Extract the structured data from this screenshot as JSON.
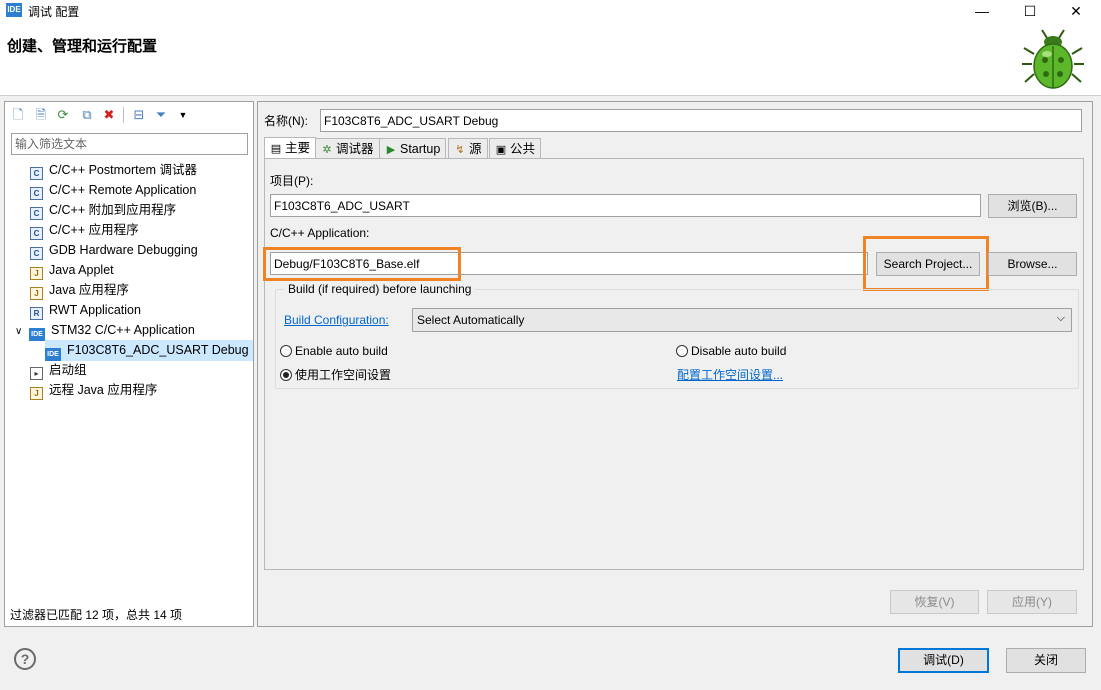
{
  "window": {
    "title": "调试 配置",
    "app_badge": "IDE",
    "minimize_glyph": "—",
    "maximize_glyph": "☐",
    "close_glyph": "✕"
  },
  "header": {
    "title": "创建、管理和运行配置"
  },
  "left": {
    "filter_placeholder": "输入筛选文本",
    "tree": [
      {
        "label": "C/C++ Postmortem 调试器",
        "icon": "c-icon",
        "badge": "C"
      },
      {
        "label": "C/C++ Remote Application",
        "icon": "c-icon",
        "badge": "C"
      },
      {
        "label": "C/C++ 附加到应用程序",
        "icon": "c-icon",
        "badge": "C"
      },
      {
        "label": "C/C++ 应用程序",
        "icon": "c-icon",
        "badge": "C"
      },
      {
        "label": "GDB Hardware Debugging",
        "icon": "c-icon",
        "badge": "C"
      },
      {
        "label": "Java Applet",
        "icon": "java-applet-icon",
        "badge": "J"
      },
      {
        "label": "Java 应用程序",
        "icon": "java-app-icon",
        "badge": "J"
      },
      {
        "label": "RWT Application",
        "icon": "rwt-icon",
        "badge": "R"
      },
      {
        "label": "STM32 C/C++ Application",
        "icon": "stm32-icon",
        "badge": "IDE"
      },
      {
        "label": "F103C8T6_ADC_USART Debug",
        "icon": "ide-config-icon",
        "badge": "IDE"
      },
      {
        "label": "启动组",
        "icon": "launch-group-icon",
        "badge": "▸"
      },
      {
        "label": "远程 Java 应用程序",
        "icon": "remote-java-icon",
        "badge": "J"
      }
    ],
    "expander": "∨",
    "status": "过滤器已匹配 12 项，总共 14 项"
  },
  "right": {
    "name_label": "名称(N):",
    "name_value": "F103C8T6_ADC_USART Debug",
    "tabs": [
      {
        "label": "主要",
        "glyph": "▤"
      },
      {
        "label": "调试器",
        "glyph": "✲"
      },
      {
        "label": "Startup",
        "glyph": "▶"
      },
      {
        "label": "源",
        "glyph": "↯"
      },
      {
        "label": "公共",
        "glyph": "▣"
      }
    ],
    "project_label": "项目(P):",
    "project_value": "F103C8T6_ADC_USART",
    "browse_p": "浏览(B)...",
    "app_label": "C/C++ Application:",
    "app_value": "Debug/F103C8T6_Base.elf",
    "search_project": "Search Project...",
    "browse": "Browse...",
    "build_legend": "Build (if required) before launching",
    "build_config_link": "Build Configuration:",
    "build_config_value": "Select Automatically",
    "enable_auto": "Enable auto build",
    "disable_auto": "Disable auto build",
    "use_workspace": "使用工作空间设置",
    "config_workspace_link": "配置工作空间设置...",
    "revert": "恢复(V)",
    "apply": "应用(Y)"
  },
  "bottom": {
    "help": "?",
    "debug": "调试(D)",
    "close": "关闭"
  },
  "colors": {
    "highlight": "#f08424",
    "link": "#0066cc",
    "selection": "#cce8ff"
  }
}
